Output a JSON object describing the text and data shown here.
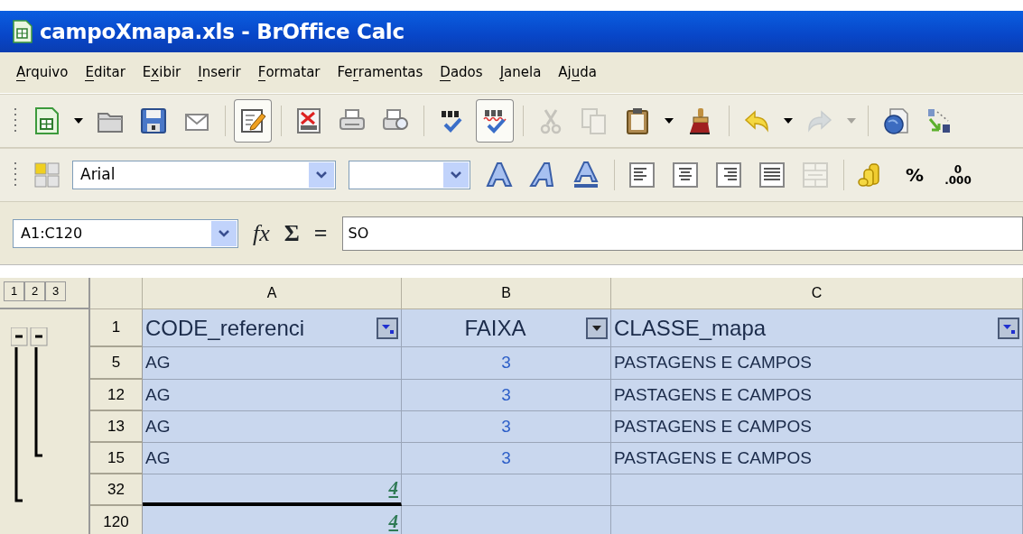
{
  "window": {
    "title": "campoXmapa.xls - BrOffice Calc"
  },
  "menu": [
    {
      "parts": [
        {
          "text": "A",
          "underlined": true
        },
        {
          "text": "rquivo",
          "underlined": false
        }
      ]
    },
    {
      "parts": [
        {
          "text": "E",
          "underlined": true
        },
        {
          "text": "ditar",
          "underlined": false
        }
      ]
    },
    {
      "parts": [
        {
          "text": "E",
          "underlined": false
        },
        {
          "text": "x",
          "underlined": true
        },
        {
          "text": "ibir",
          "underlined": false
        }
      ]
    },
    {
      "parts": [
        {
          "text": "I",
          "underlined": true
        },
        {
          "text": "nserir",
          "underlined": false
        }
      ]
    },
    {
      "parts": [
        {
          "text": "F",
          "underlined": true
        },
        {
          "text": "ormatar",
          "underlined": false
        }
      ]
    },
    {
      "parts": [
        {
          "text": "Fe",
          "underlined": false
        },
        {
          "text": "r",
          "underlined": true
        },
        {
          "text": "ramentas",
          "underlined": false
        }
      ]
    },
    {
      "parts": [
        {
          "text": "D",
          "underlined": true
        },
        {
          "text": "ados",
          "underlined": false
        }
      ]
    },
    {
      "parts": [
        {
          "text": "J",
          "underlined": true
        },
        {
          "text": "anela",
          "underlined": false
        }
      ]
    },
    {
      "parts": [
        {
          "text": "Aj",
          "underlined": false
        },
        {
          "text": "u",
          "underlined": true
        },
        {
          "text": "da",
          "underlined": false
        }
      ]
    }
  ],
  "toolbar_standard": [
    [
      {
        "kind": "new",
        "pressed": false,
        "disabled": false
      },
      {
        "kind": "dropdown",
        "pressed": false,
        "disabled": false
      },
      {
        "kind": "open",
        "pressed": false,
        "disabled": false
      },
      {
        "kind": "save",
        "pressed": false,
        "disabled": false
      },
      {
        "kind": "mail",
        "pressed": false,
        "disabled": false
      }
    ],
    [
      {
        "kind": "edit",
        "pressed": true,
        "disabled": false
      }
    ],
    [
      {
        "kind": "pdf",
        "pressed": false,
        "disabled": false
      },
      {
        "kind": "print",
        "pressed": false,
        "disabled": false
      },
      {
        "kind": "preview",
        "pressed": false,
        "disabled": false
      }
    ],
    [
      {
        "kind": "spell",
        "pressed": false,
        "disabled": false
      },
      {
        "kind": "autospell",
        "pressed": true,
        "disabled": false
      }
    ],
    [
      {
        "kind": "cut",
        "pressed": false,
        "disabled": true
      },
      {
        "kind": "copy",
        "pressed": false,
        "disabled": true
      },
      {
        "kind": "paste",
        "pressed": false,
        "disabled": false
      },
      {
        "kind": "dropdown",
        "pressed": false,
        "disabled": false
      },
      {
        "kind": "brush",
        "pressed": false,
        "disabled": false
      }
    ],
    [
      {
        "kind": "undo",
        "pressed": false,
        "disabled": false
      },
      {
        "kind": "dropdown",
        "pressed": false,
        "disabled": false
      },
      {
        "kind": "redo",
        "pressed": false,
        "disabled": true
      },
      {
        "kind": "dropdown",
        "pressed": false,
        "disabled": true
      }
    ],
    [
      {
        "kind": "navigator",
        "pressed": false,
        "disabled": false
      },
      {
        "kind": "sort",
        "pressed": false,
        "disabled": false
      }
    ]
  ],
  "toolbar_formatting": {
    "font_name": "Arial",
    "groups": [
      [
        {
          "kind": "outline",
          "disabled": false
        },
        {
          "kind": "shadow",
          "disabled": false
        },
        {
          "kind": "underline",
          "disabled": false
        }
      ],
      [
        {
          "kind": "align_left",
          "disabled": false
        },
        {
          "kind": "align_center",
          "disabled": false
        },
        {
          "kind": "align_right",
          "disabled": false
        },
        {
          "kind": "justify",
          "disabled": false
        },
        {
          "kind": "merge",
          "disabled": true
        }
      ],
      [
        {
          "kind": "currency",
          "disabled": false
        },
        {
          "kind": "text",
          "label": "%",
          "disabled": false
        },
        {
          "kind": "decimal",
          "labels": [
            "0",
            ".000"
          ],
          "disabled": false
        }
      ]
    ]
  },
  "formula_bar": {
    "name_box": "A1:C120",
    "function_label": "fx",
    "buttons": [
      "Σ",
      "="
    ],
    "content": "SO"
  },
  "outline": {
    "levels": [
      "1",
      "2",
      "3"
    ]
  },
  "sheet": {
    "columns": [
      "A",
      "B",
      "C"
    ],
    "rows": [
      {
        "header": "1",
        "kind": "filter_header",
        "rule_below": false,
        "cells": [
          {
            "text": "CODE_referenci",
            "filtered": true
          },
          {
            "text": "FAIXA",
            "filtered": false
          },
          {
            "text": "CLASSE_mapa",
            "filtered": true
          }
        ]
      },
      {
        "header": "5",
        "kind": "data",
        "rule_below": false,
        "cells": [
          {
            "text": "AG"
          },
          {
            "text": "3"
          },
          {
            "text": "PASTAGENS E CAMPOS"
          }
        ]
      },
      {
        "header": "12",
        "kind": "data",
        "rule_below": false,
        "cells": [
          {
            "text": "AG"
          },
          {
            "text": "3"
          },
          {
            "text": "PASTAGENS E CAMPOS"
          }
        ]
      },
      {
        "header": "13",
        "kind": "data",
        "rule_below": false,
        "cells": [
          {
            "text": "AG"
          },
          {
            "text": "3"
          },
          {
            "text": "PASTAGENS E CAMPOS"
          }
        ]
      },
      {
        "header": "15",
        "kind": "data",
        "rule_below": false,
        "cells": [
          {
            "text": "AG"
          },
          {
            "text": "3"
          },
          {
            "text": "PASTAGENS E CAMPOS"
          }
        ]
      },
      {
        "header": "32",
        "kind": "subtotal",
        "rule_below": true,
        "cells": [
          {
            "text": "4"
          }
        ]
      },
      {
        "header": "120",
        "kind": "subtotal",
        "rule_below": false,
        "cells": [
          {
            "text": "4"
          }
        ]
      }
    ]
  }
}
